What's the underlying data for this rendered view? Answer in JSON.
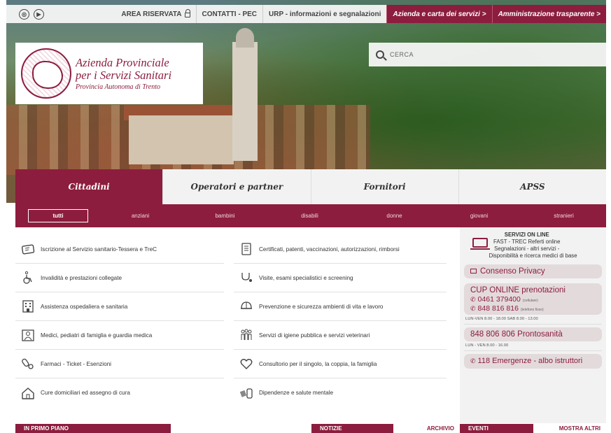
{
  "topbar": {
    "social": [
      "Instagram",
      "YouTube"
    ],
    "area_riservata": "AREA RISERVATA",
    "contatti": "CONTATTI - PEC",
    "urp": "URP - informazioni e segnalazioni",
    "azienda": "Azienda e carta dei servizi >",
    "amministrazione": "Amministrazione trasparente >"
  },
  "logo": {
    "line1": "Azienda Provinciale",
    "line2": "per i Servizi Sanitari",
    "line3": "Provincia Autonoma di Trento"
  },
  "search": {
    "placeholder": "CERCA"
  },
  "tabs": [
    "Cittadini",
    "Operatori e partner",
    "Fornitori",
    "APSS"
  ],
  "filters": [
    "tutti",
    "anziani",
    "bambini",
    "disabili",
    "donne",
    "giovani",
    "stranieri"
  ],
  "services_left": [
    {
      "label": "Iscrizione al Servizio sanitario-Tessera e TreC",
      "icon": "card-icon"
    },
    {
      "label": "Invalidità e prestazioni collegate",
      "icon": "wheelchair-icon"
    },
    {
      "label": "Assistenza ospedaliera e sanitaria",
      "icon": "hospital-icon"
    },
    {
      "label": "Medici, pediatri di famiglia e guardia medica",
      "icon": "doctor-icon"
    },
    {
      "label": "Farmaci - Ticket - Esenzioni",
      "icon": "pills-icon"
    },
    {
      "label": "Cure domiciliari ed assegno di cura",
      "icon": "home-icon"
    }
  ],
  "services_right": [
    {
      "label": "Certificati, patenti, vaccinazioni, autorizzazioni, rimborsi",
      "icon": "document-icon"
    },
    {
      "label": "Visite, esami specialistici e screening",
      "icon": "stethoscope-icon"
    },
    {
      "label": "Prevenzione e sicurezza ambienti di vita e lavoro",
      "icon": "helmet-icon"
    },
    {
      "label": "Servizi di igiene pubblica e servizi veterinari",
      "icon": "people-icon"
    },
    {
      "label": "Consultorio per il singolo, la coppia, la famiglia",
      "icon": "heart-icon"
    },
    {
      "label": "Dipendenze e salute mentale",
      "icon": "mind-icon"
    }
  ],
  "sidebar": {
    "servizi_title": "SERVIZI ON LINE",
    "servizi_line1": "FAST - TREC Referti online",
    "servizi_line2": "Segnalazioni - altri servizi -",
    "servizi_line3": "Disponibilità e ricerca medici di base",
    "consenso": "Consenso Privacy",
    "cup_title": "CUP ONLINE prenotazioni",
    "cup_phone1": "0461 379400",
    "cup_phone1_note": "(cellulare)",
    "cup_phone2": "848 816 816",
    "cup_phone2_note": "(telefono fisso)",
    "cup_hours": "LUN-VEN 8.00 - 18.00   SAB 8.00 - 13.00",
    "prontosanita": "848 806 806 Prontosanità",
    "pronto_hours": "LUN - VEN 8.00 - 16.00",
    "emergenze": "118 Emergenze - albo istruttori"
  },
  "bottom": {
    "in_primo_piano": "IN PRIMO PIANO",
    "notizie": "NOTIZIE",
    "archivio": "ARCHIVIO",
    "eventi": "EVENTI",
    "mostra_altri": "MOSTRA ALTRI"
  },
  "colors": {
    "brand": "#8c1d3e",
    "pill": "#e3dadc",
    "bar": "#f2f2f2"
  }
}
